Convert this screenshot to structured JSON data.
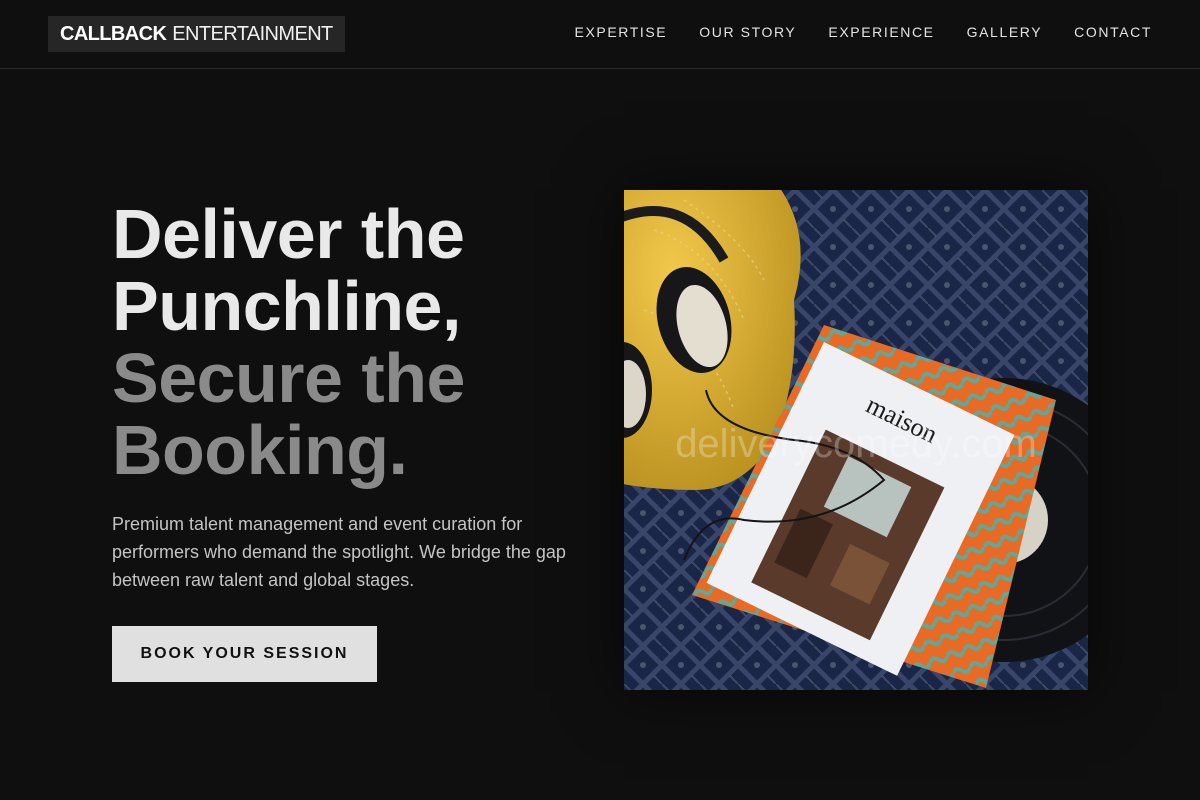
{
  "header": {
    "logo_strong": "CALLBACK",
    "logo_light": "ENTERTAINMENT",
    "nav": [
      {
        "label": "EXPERTISE"
      },
      {
        "label": "OUR STORY"
      },
      {
        "label": "EXPERIENCE"
      },
      {
        "label": "GALLERY"
      },
      {
        "label": "CONTACT"
      }
    ]
  },
  "hero": {
    "title_lines": [
      "Deliver the",
      "Punchline,",
      "Secure the",
      "Booking."
    ],
    "description": "Premium talent management and event curation for performers who demand the spotlight. We bridge the gap between raw talent and global stages.",
    "cta_label": "BOOK YOUR SESSION"
  },
  "image": {
    "magazine_title": "maison",
    "watermark": "deliverycomedy.com"
  },
  "colors": {
    "background": "#0f0f0f",
    "title_bright": "#e9e9e9",
    "title_dim": "#8a8a8a",
    "button_bg": "#e0e0e0"
  }
}
